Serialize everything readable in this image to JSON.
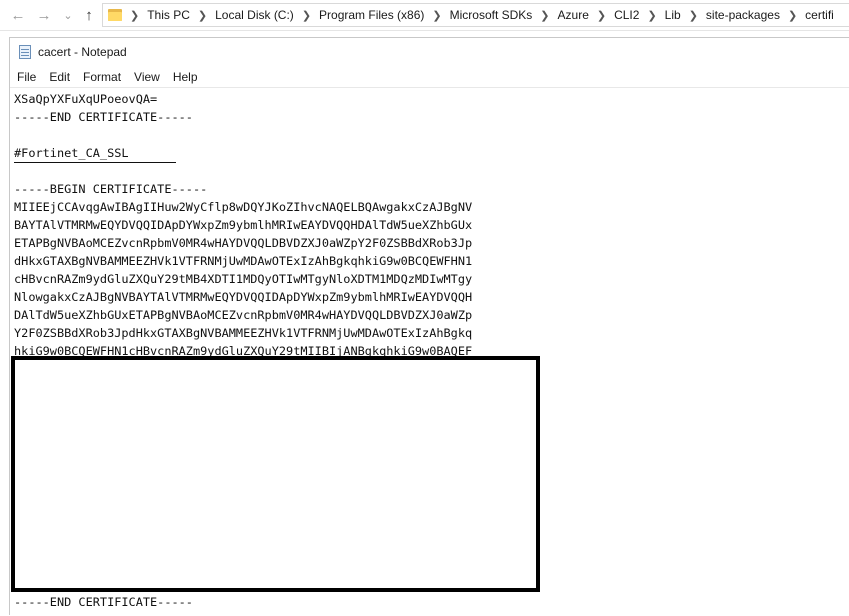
{
  "explorer": {
    "nav": {
      "back_icon": "arrow-left-icon",
      "forward_icon": "arrow-right-icon",
      "recent_icon": "chevron-down-icon",
      "up_icon": "arrow-up-icon"
    },
    "breadcrumbs": [
      "This PC",
      "Local Disk (C:)",
      "Program Files (x86)",
      "Microsoft SDKs",
      "Azure",
      "CLI2",
      "Lib",
      "site-packages",
      "certifi"
    ]
  },
  "notepad": {
    "title": "cacert - Notepad",
    "menu": [
      "File",
      "Edit",
      "Format",
      "View",
      "Help"
    ],
    "lines": [
      "XSaQpYXFuXqUPoeovQA=",
      "-----END CERTIFICATE-----",
      "",
      "#Fortinet_CA_SSL",
      "",
      "-----BEGIN CERTIFICATE-----",
      "MIIEEjCCAvqgAwIBAgIIHuw2WyCflp8wDQYJKoZIhvcNAQELBQAwgakxCzAJBgNV",
      "BAYTAlVTMRMwEQYDVQQIDApDYWxpZm9ybmlhMRIwEAYDVQQHDAlTdW5ueXZhbGUx",
      "ETAPBgNVBAoMCEZvcnRpbmV0MR4wHAYDVQQLDBVDZXJ0aWZpY2F0ZSBBdXRob3Jp",
      "dHkxGTAXBgNVBAMMEEZHVk1VTFRNMjUwMDAwOTExIzAhBgkqhkiG9w0BCQEWFHN1",
      "cHBvcnRAZm9ydGluZXQuY29tMB4XDTI1MDQyOTIwMTgyNloXDTM1MDQzMDIwMTgy",
      "NlowgakxCzAJBgNVBAYTAlVTMRMwEQYDVQQIDApDYWxpZm9ybmlhMRIwEAYDVQQH",
      "DAlTdW5ueXZhbGUxETAPBgNVBAoMCEZvcnRpbmV0MR4wHAYDVQQLDBVDZXJ0aWZp",
      "Y2F0ZSBBdXRob3JpdHkxGTAXBgNVBAMMEEZHVk1VTFRNMjUwMDAwOTExIzAhBgkq",
      "hkiG9w0BCQEWFHN1cHBvcnRAZm9ydGluZXQuY29tMIIBIjANBgkqhkiG9w0BAQEF"
    ],
    "final_line": "-----END CERTIFICATE-----"
  }
}
